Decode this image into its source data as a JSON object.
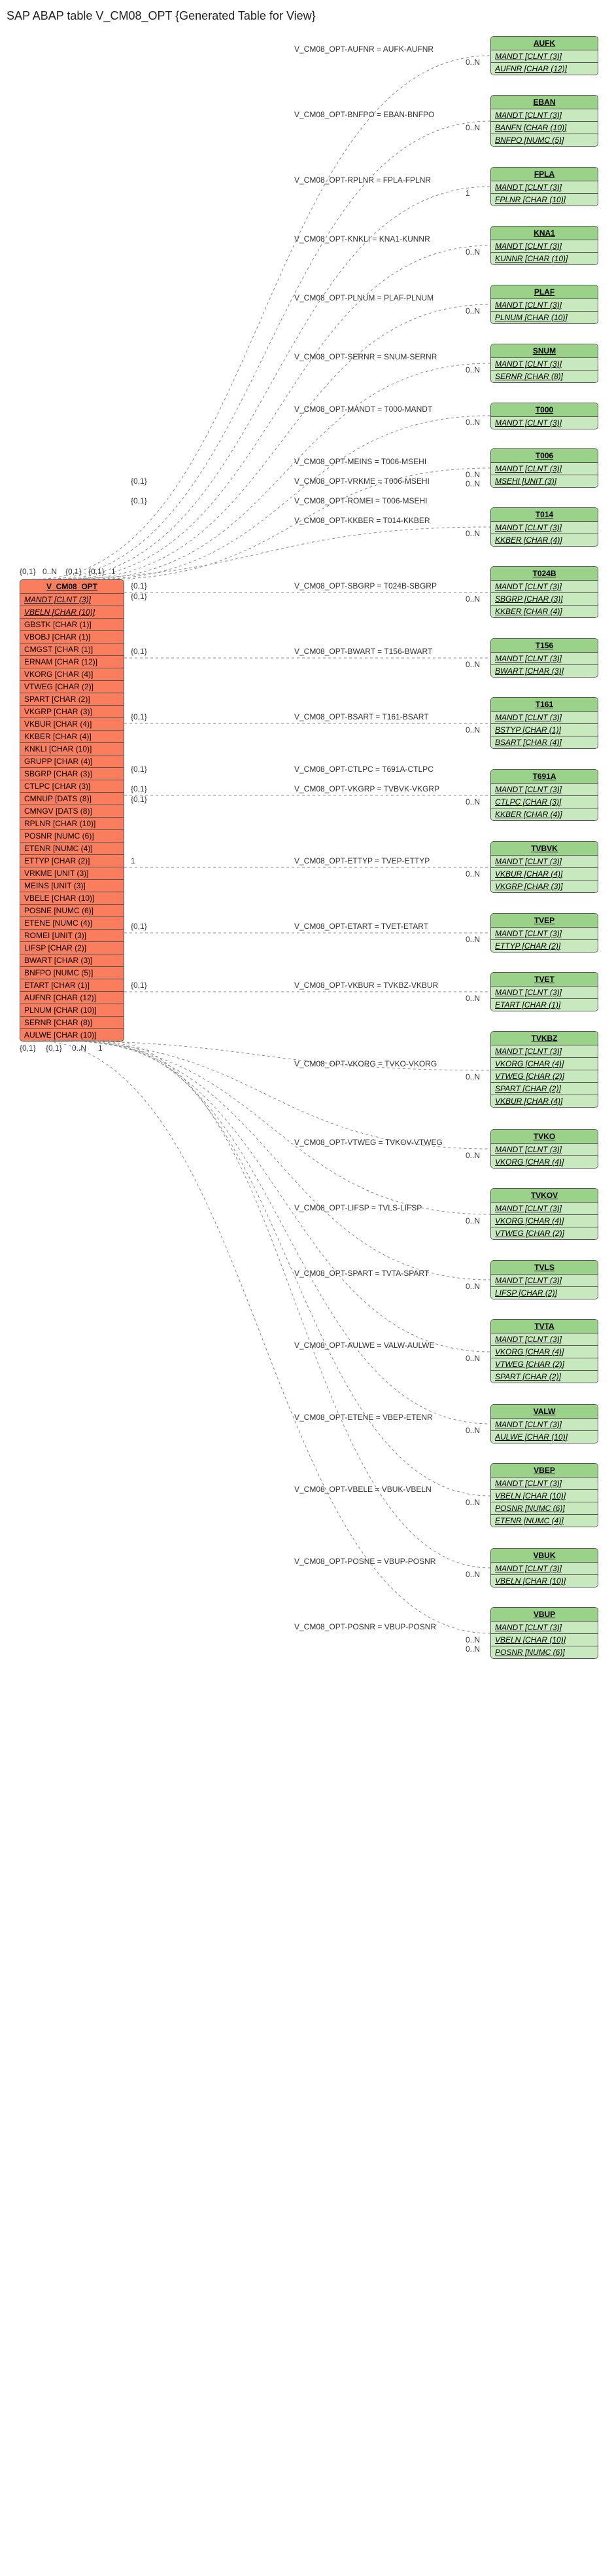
{
  "title": "SAP ABAP table V_CM08_OPT {Generated Table for View}",
  "main": {
    "name": "V_CM08_OPT",
    "fields": [
      {
        "t": "MANDT [CLNT (3)]",
        "k": true
      },
      {
        "t": "VBELN [CHAR (10)]",
        "k": true
      },
      {
        "t": "GBSTK [CHAR (1)]"
      },
      {
        "t": "VBOBJ [CHAR (1)]"
      },
      {
        "t": "CMGST [CHAR (1)]"
      },
      {
        "t": "ERNAM [CHAR (12)]"
      },
      {
        "t": "VKORG [CHAR (4)]"
      },
      {
        "t": "VTWEG [CHAR (2)]"
      },
      {
        "t": "SPART [CHAR (2)]"
      },
      {
        "t": "VKGRP [CHAR (3)]"
      },
      {
        "t": "VKBUR [CHAR (4)]"
      },
      {
        "t": "KKBER [CHAR (4)]"
      },
      {
        "t": "KNKLI [CHAR (10)]"
      },
      {
        "t": "GRUPP [CHAR (4)]"
      },
      {
        "t": "SBGRP [CHAR (3)]"
      },
      {
        "t": "CTLPC [CHAR (3)]"
      },
      {
        "t": "CMNUP [DATS (8)]"
      },
      {
        "t": "CMNGV [DATS (8)]"
      },
      {
        "t": "RPLNR [CHAR (10)]"
      },
      {
        "t": "POSNR [NUMC (6)]"
      },
      {
        "t": "ETENR [NUMC (4)]"
      },
      {
        "t": "ETTYP [CHAR (2)]"
      },
      {
        "t": "VRKME [UNIT (3)]"
      },
      {
        "t": "MEINS [UNIT (3)]"
      },
      {
        "t": "VBELE [CHAR (10)]"
      },
      {
        "t": "POSNE [NUMC (6)]"
      },
      {
        "t": "ETENE [NUMC (4)]"
      },
      {
        "t": "ROMEI [UNIT (3)]"
      },
      {
        "t": "LIFSP [CHAR (2)]"
      },
      {
        "t": "BWART [CHAR (3)]"
      },
      {
        "t": "BNFPO [NUMC (5)]"
      },
      {
        "t": "ETART [CHAR (1)]"
      },
      {
        "t": "AUFNR [CHAR (12)]"
      },
      {
        "t": "PLNUM [CHAR (10)]"
      },
      {
        "t": "SERNR [CHAR (8)]"
      },
      {
        "t": "AULWE [CHAR (10)]"
      }
    ]
  },
  "rels": [
    {
      "name": "AUFK",
      "fields": [
        {
          "t": "MANDT [CLNT (3)]",
          "k": true
        },
        {
          "t": "AUFNR [CHAR (12)]",
          "k": true
        }
      ],
      "label": "V_CM08_OPT-AUFNR = AUFK-AUFNR",
      "card": "0..N"
    },
    {
      "name": "EBAN",
      "fields": [
        {
          "t": "MANDT [CLNT (3)]",
          "k": true
        },
        {
          "t": "BANFN [CHAR (10)]",
          "k": true
        },
        {
          "t": "BNFPO [NUMC (5)]",
          "k": true
        }
      ],
      "label": "V_CM08_OPT-BNFPO = EBAN-BNFPO",
      "card": "0..N"
    },
    {
      "name": "FPLA",
      "fields": [
        {
          "t": "MANDT [CLNT (3)]",
          "k": true
        },
        {
          "t": "FPLNR [CHAR (10)]",
          "k": true
        }
      ],
      "label": "V_CM08_OPT-RPLNR = FPLA-FPLNR",
      "card": "1"
    },
    {
      "name": "KNA1",
      "fields": [
        {
          "t": "MANDT [CLNT (3)]",
          "k": true
        },
        {
          "t": "KUNNR [CHAR (10)]",
          "k": true
        }
      ],
      "label": "V_CM08_OPT-KNKLI = KNA1-KUNNR",
      "card": "0..N"
    },
    {
      "name": "PLAF",
      "fields": [
        {
          "t": "MANDT [CLNT (3)]",
          "k": true
        },
        {
          "t": "PLNUM [CHAR (10)]",
          "k": true
        }
      ],
      "label": "V_CM08_OPT-PLNUM = PLAF-PLNUM",
      "card": "0..N"
    },
    {
      "name": "SNUM",
      "fields": [
        {
          "t": "MANDT [CLNT (3)]",
          "k": true
        },
        {
          "t": "SERNR [CHAR (8)]",
          "k": true
        }
      ],
      "label": "V_CM08_OPT-SERNR = SNUM-SERNR",
      "card": "0..N"
    },
    {
      "name": "T000",
      "fields": [
        {
          "t": "MANDT [CLNT (3)]",
          "k": true
        }
      ],
      "label": "V_CM08_OPT-MANDT = T000-MANDT",
      "card": "0..N"
    },
    {
      "name": "T006",
      "fields": [
        {
          "t": "MANDT [CLNT (3)]",
          "k": true
        },
        {
          "t": "MSEHI [UNIT (3)]",
          "k": true
        }
      ],
      "label": "V_CM08_OPT-MEINS = T006-MSEHI",
      "card": "0..N",
      "card2": "0..N"
    },
    {
      "name": "T014",
      "fields": [
        {
          "t": "MANDT [CLNT (3)]",
          "k": true
        },
        {
          "t": "KKBER [CHAR (4)]",
          "k": true
        }
      ],
      "label": "V_CM08_OPT-KKBER = T014-KKBER",
      "card": "0..N",
      "extraLabels": [
        {
          "t": "V_CM08_OPT-ROMEI = T006-MSEHI",
          "c": "{0,1}"
        },
        {
          "t": "V_CM08_OPT-VRKME = T006-MSEHI",
          "c": "{0,1}"
        }
      ]
    },
    {
      "name": "T024B",
      "fields": [
        {
          "t": "MANDT [CLNT (3)]",
          "k": true
        },
        {
          "t": "SBGRP [CHAR (3)]",
          "k": true
        },
        {
          "t": "KKBER [CHAR (4)]",
          "k": true
        }
      ],
      "label": "V_CM08_OPT-SBGRP = T024B-SBGRP",
      "card": "0..N",
      "pre": "{0,1}",
      "pre2": "{0,1}"
    },
    {
      "name": "T156",
      "fields": [
        {
          "t": "MANDT [CLNT (3)]",
          "k": true
        },
        {
          "t": "BWART [CHAR (3)]",
          "k": true
        }
      ],
      "label": "V_CM08_OPT-BWART = T156-BWART",
      "card": "0..N",
      "pre": "{0,1}"
    },
    {
      "name": "T161",
      "fields": [
        {
          "t": "MANDT [CLNT (3)]",
          "k": true
        },
        {
          "t": "BSTYP [CHAR (1)]",
          "k": true
        },
        {
          "t": "BSART [CHAR (4)]",
          "k": true
        }
      ],
      "label": "V_CM08_OPT-BSART = T161-BSART",
      "card": "0..N",
      "pre": "{0,1}"
    },
    {
      "name": "T691A",
      "fields": [
        {
          "t": "MANDT [CLNT (3)]",
          "k": true
        },
        {
          "t": "CTLPC [CHAR (3)]",
          "k": true
        },
        {
          "t": "KKBER [CHAR (4)]",
          "k": true
        }
      ],
      "label": "V_CM08_OPT-VKGRP = TVBVK-VKGRP",
      "card": "0..N",
      "extraLabels": [
        {
          "t": "V_CM08_OPT-CTLPC = T691A-CTLPC",
          "c": "{0,1}"
        }
      ],
      "pre": "{0,1}",
      "pre2": "{0,1}"
    },
    {
      "name": "TVBVK",
      "fields": [
        {
          "t": "MANDT [CLNT (3)]",
          "k": true
        },
        {
          "t": "VKBUR [CHAR (4)]",
          "k": true
        },
        {
          "t": "VKGRP [CHAR (3)]",
          "k": true
        }
      ],
      "label": "V_CM08_OPT-ETTYP = TVEP-ETTYP",
      "card": "0..N",
      "pre": "1"
    },
    {
      "name": "TVEP",
      "fields": [
        {
          "t": "MANDT [CLNT (3)]",
          "k": true
        },
        {
          "t": "ETTYP [CHAR (2)]",
          "k": true
        }
      ],
      "label": "V_CM08_OPT-ETART = TVET-ETART",
      "card": "0..N",
      "pre": "{0,1}"
    },
    {
      "name": "TVET",
      "fields": [
        {
          "t": "MANDT [CLNT (3)]",
          "k": true
        },
        {
          "t": "ETART [CHAR (1)]",
          "k": true
        }
      ],
      "label": "V_CM08_OPT-VKBUR = TVKBZ-VKBUR",
      "card": "0..N",
      "pre": "{0,1}"
    },
    {
      "name": "TVKBZ",
      "fields": [
        {
          "t": "MANDT [CLNT (3)]",
          "k": true
        },
        {
          "t": "VKORG [CHAR (4)]",
          "k": true
        },
        {
          "t": "VTWEG [CHAR (2)]",
          "k": true
        },
        {
          "t": "SPART [CHAR (2)]",
          "k": true
        },
        {
          "t": "VKBUR [CHAR (4)]",
          "k": true
        }
      ],
      "label": "V_CM08_OPT-VKORG = TVKO-VKORG",
      "card": "0..N"
    },
    {
      "name": "TVKO",
      "fields": [
        {
          "t": "MANDT [CLNT (3)]",
          "k": true
        },
        {
          "t": "VKORG [CHAR (4)]",
          "k": true
        }
      ],
      "label": "V_CM08_OPT-VTWEG = TVKOV-VTWEG",
      "card": "0..N"
    },
    {
      "name": "TVKOV",
      "fields": [
        {
          "t": "MANDT [CLNT (3)]",
          "k": true
        },
        {
          "t": "VKORG [CHAR (4)]",
          "k": true
        },
        {
          "t": "VTWEG [CHAR (2)]",
          "k": true
        }
      ],
      "label": "V_CM08_OPT-LIFSP = TVLS-LIFSP",
      "card": "0..N"
    },
    {
      "name": "TVLS",
      "fields": [
        {
          "t": "MANDT [CLNT (3)]",
          "k": true
        },
        {
          "t": "LIFSP [CHAR (2)]",
          "k": true
        }
      ],
      "label": "V_CM08_OPT-SPART = TVTA-SPART",
      "card": "0..N"
    },
    {
      "name": "TVTA",
      "fields": [
        {
          "t": "MANDT [CLNT (3)]",
          "k": true
        },
        {
          "t": "VKORG [CHAR (4)]",
          "k": true
        },
        {
          "t": "VTWEG [CHAR (2)]",
          "k": true
        },
        {
          "t": "SPART [CHAR (2)]",
          "k": true
        }
      ],
      "label": "V_CM08_OPT-AULWE = VALW-AULWE",
      "card": "0..N"
    },
    {
      "name": "VALW",
      "fields": [
        {
          "t": "MANDT [CLNT (3)]",
          "k": true
        },
        {
          "t": "AULWE [CHAR (10)]",
          "k": true
        }
      ],
      "label": "V_CM08_OPT-ETENE = VBEP-ETENR",
      "card": "0..N"
    },
    {
      "name": "VBEP",
      "fields": [
        {
          "t": "MANDT [CLNT (3)]",
          "k": true
        },
        {
          "t": "VBELN [CHAR (10)]",
          "k": true
        },
        {
          "t": "POSNR [NUMC (6)]",
          "k": true
        },
        {
          "t": "ETENR [NUMC (4)]",
          "k": true
        }
      ],
      "label": "V_CM08_OPT-VBELE = VBUK-VBELN",
      "card": "0..N"
    },
    {
      "name": "VBUK",
      "fields": [
        {
          "t": "MANDT [CLNT (3)]",
          "k": true
        },
        {
          "t": "VBELN [CHAR (10)]",
          "k": true
        }
      ],
      "label": "V_CM08_OPT-POSNE = VBUP-POSNR",
      "card": "0..N"
    },
    {
      "name": "VBUP",
      "fields": [
        {
          "t": "MANDT [CLNT (3)]",
          "k": true
        },
        {
          "t": "VBELN [CHAR (10)]",
          "k": true
        },
        {
          "t": "POSNR [NUMC (6)]",
          "k": true
        }
      ],
      "label": "V_CM08_OPT-POSNR = VBUP-POSNR",
      "card": "0..N",
      "card2": "0..N"
    }
  ],
  "bottomAnnots": [
    "{0,1}",
    "{0,1}",
    "0..N",
    "1"
  ],
  "topAnnots": [
    "{0,1}",
    "0..N",
    "{0,1}",
    "{0,1}",
    "1"
  ]
}
